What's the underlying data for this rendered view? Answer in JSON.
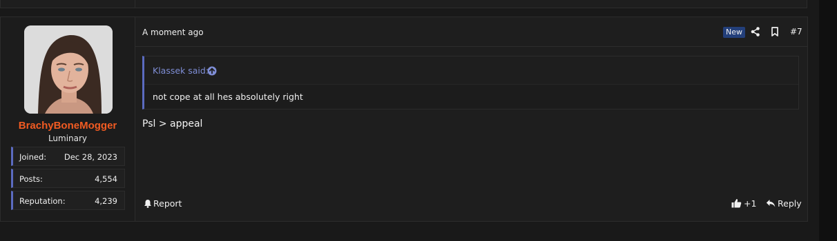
{
  "user": {
    "username": "BrachyBoneMogger",
    "title": "Luminary",
    "stats": [
      {
        "label": "Joined:",
        "value": "Dec 28, 2023"
      },
      {
        "label": "Posts:",
        "value": "4,554"
      },
      {
        "label": "Reputation:",
        "value": "4,239"
      }
    ]
  },
  "post": {
    "timestamp": "A moment ago",
    "badge": "New",
    "number": "#7",
    "quote": {
      "author": "Klassek said:",
      "text": "not cope at all hes absolutely right"
    },
    "message": "Psl > appeal"
  },
  "footer": {
    "report_label": "Report",
    "like_label": "+1",
    "reply_label": "Reply"
  },
  "colors": {
    "username": "#f15b22",
    "accent": "#5b6bc0",
    "badge_bg": "#233f7a",
    "background": "#191919"
  },
  "icons": [
    "share-icon",
    "bookmark-icon",
    "arrow-up-circle-icon",
    "bell-icon",
    "thumbs-up-icon",
    "reply-icon"
  ]
}
